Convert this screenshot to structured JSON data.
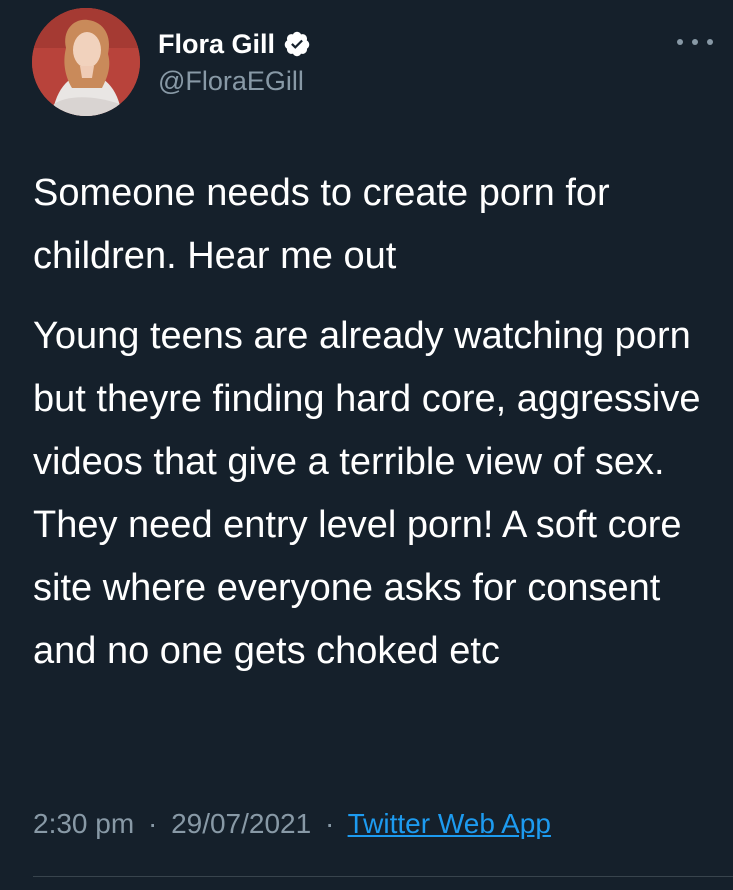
{
  "tweet": {
    "author": {
      "display_name": "Flora Gill",
      "handle": "@FloraEGill",
      "verified": true
    },
    "paragraphs": [
      "Someone needs to create porn for children. Hear me out",
      "Young teens are already watching porn but theyre finding hard core, aggressive videos that give a terrible view of sex. They need entry level porn! A soft core site where everyone asks for consent and no one gets choked etc"
    ],
    "time": "2:30 pm",
    "separator": "·",
    "date": "29/07/2021",
    "source": "Twitter Web App"
  },
  "icons": {
    "verified": "verified-badge-icon",
    "more": "more-horizontal-icon"
  },
  "colors": {
    "background": "#15202b",
    "text_primary": "#ffffff",
    "text_secondary": "#8899a6",
    "link": "#1d9bf0",
    "divider": "#38444d"
  }
}
